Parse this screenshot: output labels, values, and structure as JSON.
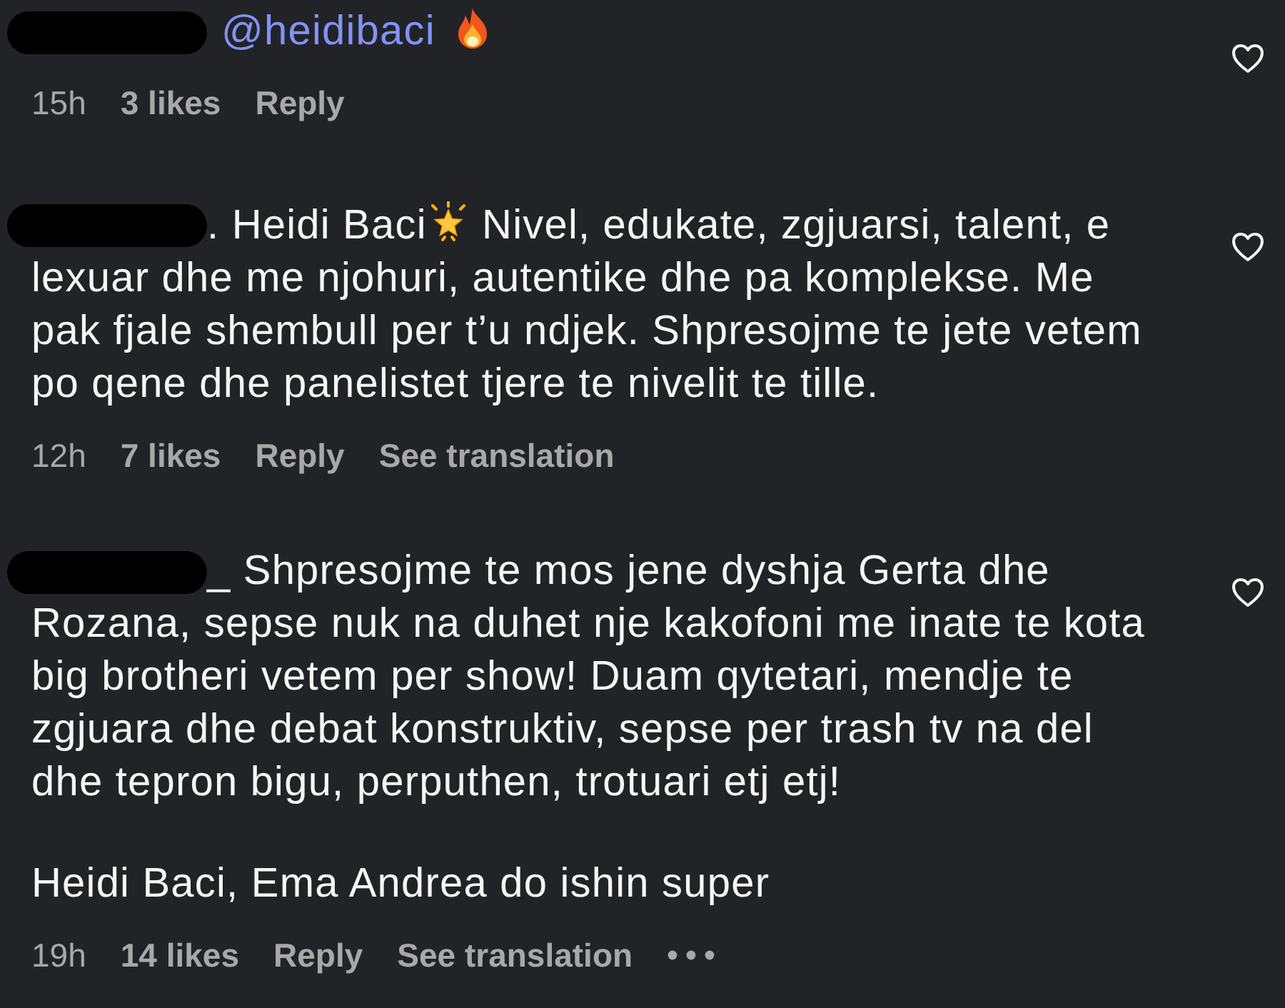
{
  "comments": [
    {
      "paragraphs": [
        [
          [
            {
              "kind": "mention",
              "text": "@heidibaci"
            },
            {
              "kind": "fire"
            }
          ]
        ]
      ],
      "time": "15h",
      "likes": "3 likes",
      "actions": [
        "Reply"
      ],
      "more": false,
      "liked": false
    },
    {
      "paragraphs": [
        [
          [
            {
              "kind": "text",
              "text": ". Heidi Baci"
            },
            {
              "kind": "star"
            },
            {
              "kind": "text",
              "text": " Nivel, edukate, zgjuarsi, talent, e"
            }
          ],
          [
            {
              "kind": "text",
              "text": "lexuar dhe me njohuri, autentike dhe pa komplekse. Me"
            }
          ],
          [
            {
              "kind": "text",
              "text": "pak fjale shembull per t’u ndjek. Shpresojme te jete vetem"
            }
          ],
          [
            {
              "kind": "text",
              "text": "po qene dhe panelistet tjere te nivelit te tille."
            }
          ]
        ]
      ],
      "time": "12h",
      "likes": "7 likes",
      "actions": [
        "Reply",
        "See translation"
      ],
      "more": false,
      "liked": false
    },
    {
      "paragraphs": [
        [
          [
            {
              "kind": "text",
              "text": "_ Shpresojme te mos jene dyshja Gerta dhe"
            }
          ],
          [
            {
              "kind": "text",
              "text": "Rozana, sepse nuk na duhet nje kakofoni me inate te kota"
            }
          ],
          [
            {
              "kind": "text",
              "text": "big brotheri vetem per show! Duam qytetari, mendje te"
            }
          ],
          [
            {
              "kind": "text",
              "text": "zgjuara dhe debat konstruktiv, sepse per trash tv na del"
            }
          ],
          [
            {
              "kind": "text",
              "text": "dhe tepron bigu, perputhen, trotuari etj etj!"
            }
          ]
        ],
        [
          [
            {
              "kind": "text",
              "text": "Heidi Baci, Ema Andrea do ishin super"
            }
          ]
        ]
      ],
      "time": "19h",
      "likes": "14 likes",
      "actions": [
        "Reply",
        "See translation"
      ],
      "more": true,
      "liked": false
    }
  ]
}
